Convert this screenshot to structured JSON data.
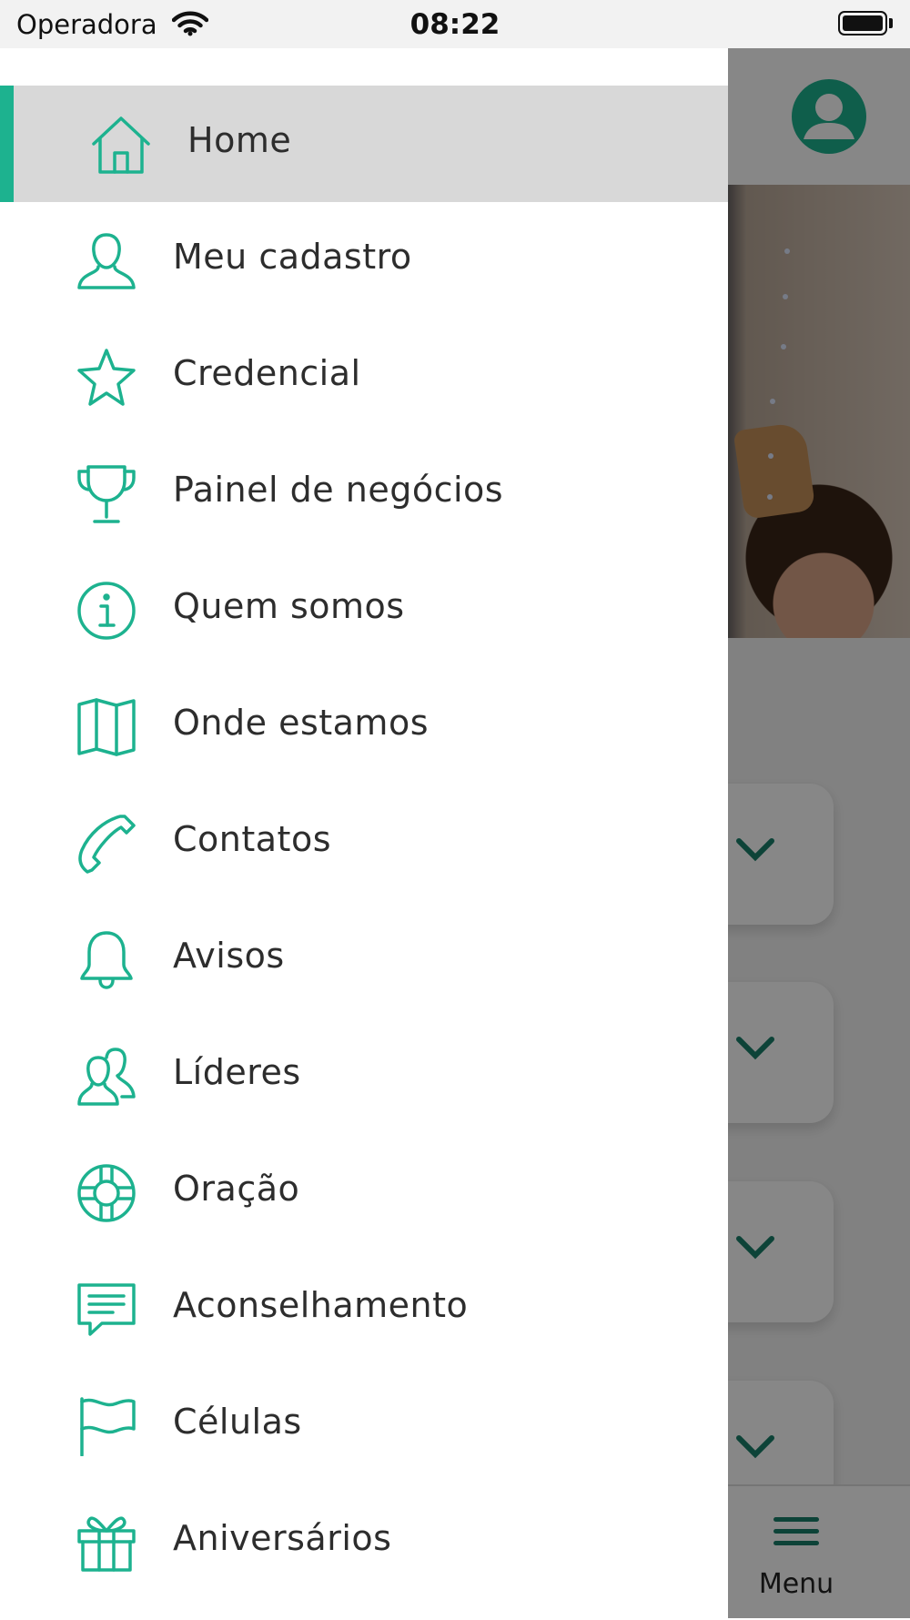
{
  "status_bar": {
    "carrier": "Operadora",
    "time": "08:22"
  },
  "drawer": {
    "items": [
      {
        "label": "Home",
        "icon": "home-icon",
        "active": true
      },
      {
        "label": "Meu cadastro",
        "icon": "user-icon"
      },
      {
        "label": "Credencial",
        "icon": "star-icon"
      },
      {
        "label": "Painel de negócios",
        "icon": "trophy-icon"
      },
      {
        "label": "Quem somos",
        "icon": "info-icon"
      },
      {
        "label": "Onde estamos",
        "icon": "map-icon"
      },
      {
        "label": "Contatos",
        "icon": "phone-icon"
      },
      {
        "label": "Avisos",
        "icon": "bell-icon"
      },
      {
        "label": "Líderes",
        "icon": "users-icon"
      },
      {
        "label": "Oração",
        "icon": "lifebuoy-icon"
      },
      {
        "label": "Aconselhamento",
        "icon": "chat-icon"
      },
      {
        "label": "Células",
        "icon": "flag-icon"
      },
      {
        "label": "Aniversários",
        "icon": "gift-icon"
      }
    ]
  },
  "tabbar": {
    "menu_label": "Menu"
  },
  "colors": {
    "accent": "#1DB28F",
    "text": "#2D2D2D",
    "active_bg": "#D8D8D8"
  }
}
